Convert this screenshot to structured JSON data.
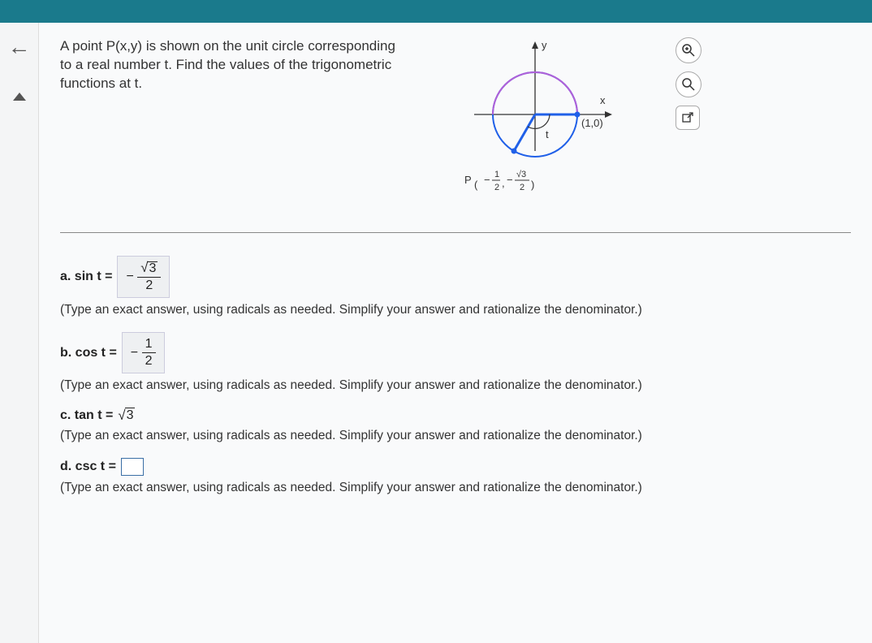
{
  "prompt": "A point P(x,y) is shown on the unit circle corresponding to a real number t. Find the values of the trigonometric functions at t.",
  "figure": {
    "y_label": "y",
    "x_label": "x",
    "point_label": "(1,0)",
    "angle_label": "t",
    "p_prefix": "P",
    "p_x_num": "1",
    "p_x_den": "2",
    "p_y_num": "√3",
    "p_y_den": "2"
  },
  "tools": {
    "zoom_in": "⊕",
    "zoom_out": "⌕",
    "popout": "⇱"
  },
  "parts": {
    "a": {
      "label": "a. sin t =",
      "minus": "−",
      "num": "3",
      "den": "2"
    },
    "b": {
      "label": "b. cos t =",
      "minus": "−",
      "num": "1",
      "den": "2"
    },
    "c": {
      "label": "c. tan t =",
      "val": "3"
    },
    "d": {
      "label": "d. csc t ="
    }
  },
  "hint": "(Type an exact answer, using radicals as needed. Simplify your answer and rationalize the denominator.)",
  "hint_cut": "(Type an exact answer, using radicals as needed. Simplify your answer and rationalize the denominator.)"
}
